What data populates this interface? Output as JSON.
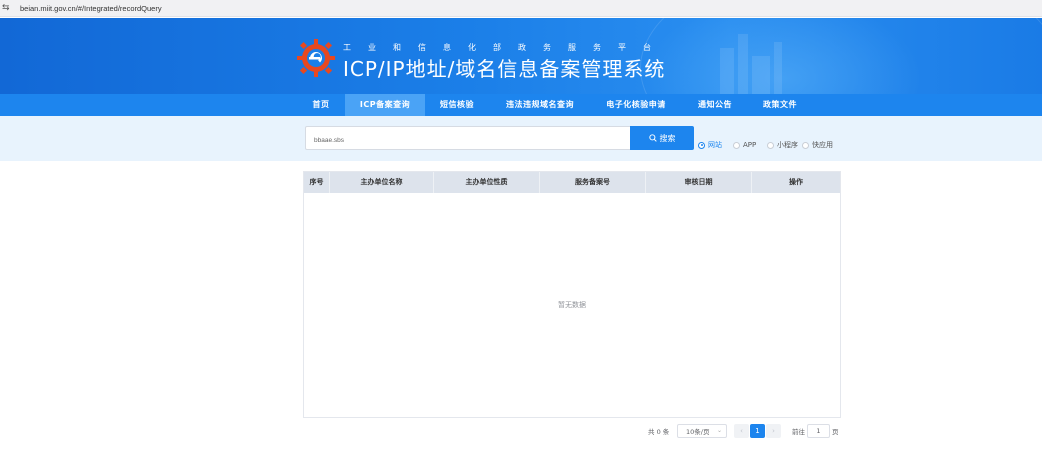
{
  "browser": {
    "url": "beian.miit.gov.cn/#/Integrated/recordQuery"
  },
  "header": {
    "subtitle": "工业和信息化部政务服务平台",
    "title": "ICP/IP地址/域名信息备案管理系统"
  },
  "nav": {
    "items": [
      {
        "label": "首页"
      },
      {
        "label": "ICP备案查询"
      },
      {
        "label": "短信核验"
      },
      {
        "label": "违法违规域名查询"
      },
      {
        "label": "电子化核验申请"
      },
      {
        "label": "通知公告"
      },
      {
        "label": "政策文件"
      }
    ],
    "active_index": 1
  },
  "search": {
    "value": "bbaae.sbs",
    "button_label": "搜索",
    "options": [
      {
        "label": "网站",
        "checked": true
      },
      {
        "label": "APP",
        "checked": false
      },
      {
        "label": "小程序",
        "checked": false
      },
      {
        "label": "快应用",
        "checked": false
      }
    ]
  },
  "table": {
    "columns": [
      "序号",
      "主办单位名称",
      "主办单位性质",
      "服务备案号",
      "审核日期",
      "操作"
    ],
    "rows": [],
    "empty_text": "暂无数据"
  },
  "pagination": {
    "total_text": "共 0 条",
    "page_size": "10条/页",
    "current_page": "1",
    "prev": "‹",
    "next": "›",
    "goto_label": "前往",
    "goto_value": "1",
    "page_suffix": "页"
  },
  "colors": {
    "primary": "#1d85ee",
    "banner": "#1b7fe8",
    "search_band": "#e8f3fd",
    "table_header": "#dde3ec"
  }
}
